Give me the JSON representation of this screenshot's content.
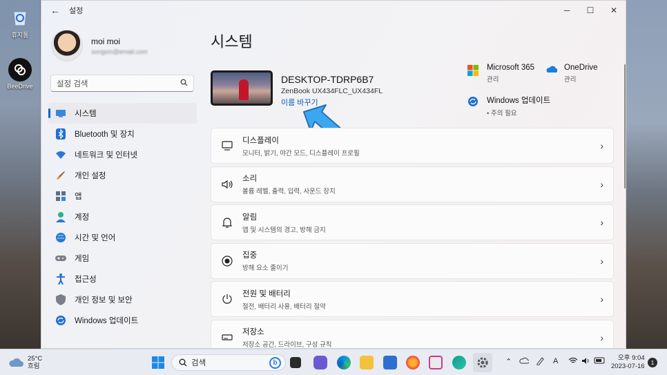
{
  "desktop": {
    "icons": [
      {
        "label": "휴지통",
        "icon": "recycle-bin-icon"
      },
      {
        "label": "BeeDrive",
        "icon": "beedrive-icon"
      }
    ]
  },
  "window": {
    "title": "설정",
    "controls": {
      "minimize": "─",
      "maximize": "☐",
      "close": "✕"
    },
    "back_icon": "←"
  },
  "profile": {
    "name": "moi moi",
    "email": "songsm@email.com"
  },
  "search": {
    "placeholder": "설정 검색"
  },
  "nav": [
    {
      "label": "시스템",
      "icon": "system-icon",
      "active": true
    },
    {
      "label": "Bluetooth 및 장치",
      "icon": "bluetooth-icon"
    },
    {
      "label": "네트워크 및 인터넷",
      "icon": "network-icon"
    },
    {
      "label": "개인 설정",
      "icon": "brush-icon"
    },
    {
      "label": "앱",
      "icon": "apps-icon"
    },
    {
      "label": "계정",
      "icon": "account-icon"
    },
    {
      "label": "시간 및 언어",
      "icon": "globe-icon"
    },
    {
      "label": "게임",
      "icon": "gamepad-icon"
    },
    {
      "label": "접근성",
      "icon": "accessibility-icon"
    },
    {
      "label": "개인 정보 및 보안",
      "icon": "shield-icon"
    },
    {
      "label": "Windows 업데이트",
      "icon": "update-icon"
    }
  ],
  "main": {
    "title": "시스템",
    "device": {
      "name": "DESKTOP-TDRP6B7",
      "model": "ZenBook UX434FLC_UX434FL",
      "rename": "이름 바꾸기"
    },
    "quick": [
      {
        "title": "Microsoft 365",
        "sub": "관리",
        "icon": "microsoft365-icon"
      },
      {
        "title": "OneDrive",
        "sub": "관리",
        "icon": "onedrive-icon"
      },
      {
        "title": "Windows 업데이트",
        "sub": "• 주의 필요",
        "icon": "windows-update-icon"
      }
    ],
    "cards": [
      {
        "title": "디스플레이",
        "sub": "모니터, 밝기, 야간 모드, 디스플레이 프로필",
        "icon": "display-icon"
      },
      {
        "title": "소리",
        "sub": "볼륨 레벨, 출력, 입력, 사운드 장치",
        "icon": "speaker-icon"
      },
      {
        "title": "알림",
        "sub": "앱 및 시스템의 경고, 방해 금지",
        "icon": "bell-icon"
      },
      {
        "title": "집중",
        "sub": "방해 요소 줄이기",
        "icon": "focus-icon"
      },
      {
        "title": "전원 및 배터리",
        "sub": "절전, 배터리 사용, 배터리 절약",
        "icon": "power-icon"
      },
      {
        "title": "저장소",
        "sub": "저장소 공간, 드라이브, 구성 규칙",
        "icon": "storage-icon"
      }
    ]
  },
  "taskbar": {
    "weather": {
      "temp": "25°C",
      "desc": "흐림"
    },
    "search": "검색",
    "tray_glyphs": {
      "chevron": "⌃",
      "font": "A"
    },
    "clock": {
      "time": "오후 9:04",
      "date": "2023-07-16"
    },
    "notifications": "1"
  }
}
